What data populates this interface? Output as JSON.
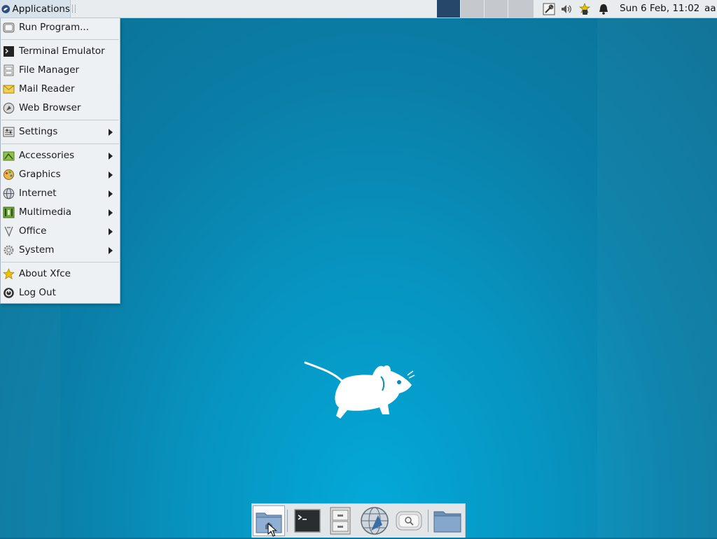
{
  "panel": {
    "applications_label": "Applications",
    "workspaces": [
      "ws1",
      "ws2",
      "ws3",
      "ws4"
    ],
    "tray_icons": [
      "network-icon",
      "volume-icon",
      "updates-icon",
      "notification-bell-icon"
    ],
    "clock": "Sun  6 Feb, 11:02",
    "user": "aa"
  },
  "menu": {
    "items": [
      {
        "label": "Run Program...",
        "icon": "run-icon",
        "submenu": false
      },
      {
        "label": "Terminal Emulator",
        "icon": "terminal-icon",
        "submenu": false
      },
      {
        "label": "File Manager",
        "icon": "file-manager-icon",
        "submenu": false
      },
      {
        "label": "Mail Reader",
        "icon": "mail-icon",
        "submenu": false
      },
      {
        "label": "Web Browser",
        "icon": "web-browser-icon",
        "submenu": false
      },
      {
        "label": "Settings",
        "icon": "settings-icon",
        "submenu": true
      },
      {
        "label": "Accessories",
        "icon": "accessories-icon",
        "submenu": true
      },
      {
        "label": "Graphics",
        "icon": "graphics-icon",
        "submenu": true
      },
      {
        "label": "Internet",
        "icon": "internet-icon",
        "submenu": true
      },
      {
        "label": "Multimedia",
        "icon": "multimedia-icon",
        "submenu": true
      },
      {
        "label": "Office",
        "icon": "office-icon",
        "submenu": true
      },
      {
        "label": "System",
        "icon": "system-icon",
        "submenu": true
      },
      {
        "label": "About Xfce",
        "icon": "about-star-icon",
        "submenu": false
      },
      {
        "label": "Log Out",
        "icon": "logout-icon",
        "submenu": false
      }
    ]
  },
  "dock": {
    "items": [
      "home-folder-icon",
      "terminal-icon",
      "file-cabinet-icon",
      "web-browser-icon",
      "app-finder-icon",
      "folder-icon"
    ]
  },
  "desktop": {
    "wallpaper_logo": "xfce-mouse-logo"
  }
}
